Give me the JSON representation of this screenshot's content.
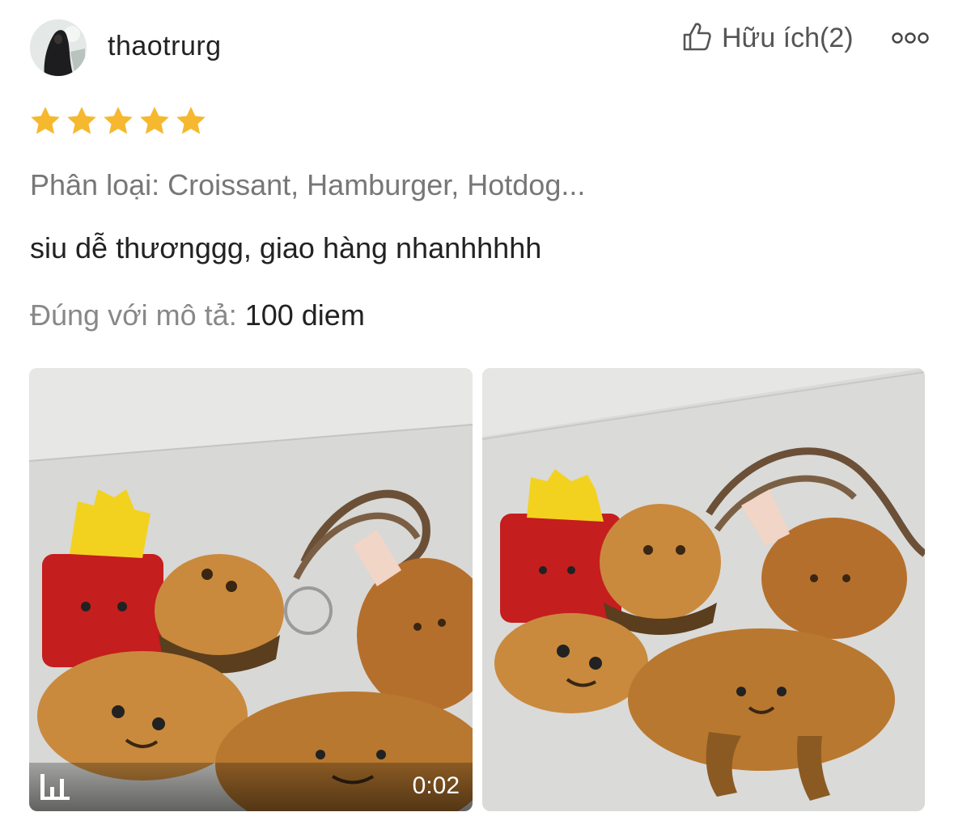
{
  "review": {
    "username": "thaotrurg",
    "helpful_label": "Hữu ích(2)",
    "rating": 5,
    "variation": "Phân loại: Croissant, Hamburger, Hotdog...",
    "comment": "siu dễ thươnggg, giao hàng nhanhhhhh",
    "attribute_label": "Đúng với mô tả:",
    "attribute_value": " 100 diem",
    "video_duration": "0:02"
  },
  "icons": {
    "like": "thumbs-up-icon",
    "more": "more-dots-icon",
    "star": "star-icon",
    "video": "video-bars-icon"
  },
  "colors": {
    "star": "#f5b82e",
    "muted_text": "#777777",
    "primary_text": "#222222"
  }
}
